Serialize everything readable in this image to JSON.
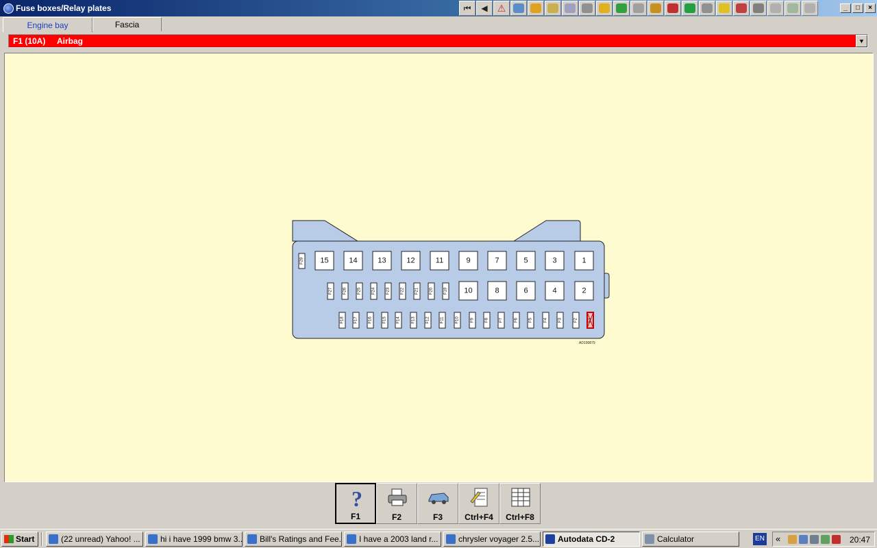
{
  "window": {
    "title": "Fuse boxes/Relay plates",
    "controls": [
      "_",
      "□",
      "×"
    ]
  },
  "toolbar": {
    "buttons": [
      {
        "icon": "first-page-icon",
        "glyph": "⏮"
      },
      {
        "icon": "back-icon",
        "glyph": "◀"
      },
      {
        "icon": "warning-icon",
        "glyph": "⚠"
      },
      {
        "icon": "engine-data-icon",
        "color": "#5a8ec8"
      },
      {
        "icon": "ignition-icon",
        "color": "#e0a020"
      },
      {
        "icon": "spark-plug-icon",
        "color": "#c8b050"
      },
      {
        "icon": "timing-icon",
        "color": "#a0a0c0"
      },
      {
        "icon": "suspension-icon",
        "color": "#909090"
      },
      {
        "icon": "fuse-icon",
        "color": "#e0b020"
      },
      {
        "icon": "relay-icon",
        "color": "#30a040"
      },
      {
        "icon": "brakes-icon",
        "color": "#a0a0a0"
      },
      {
        "icon": "tool-icon",
        "color": "#c89020"
      },
      {
        "icon": "injection-icon",
        "color": "#c03030"
      },
      {
        "icon": "electrical-icon",
        "color": "#20a040"
      },
      {
        "icon": "belt-icon",
        "color": "#909090"
      },
      {
        "icon": "fault-code-icon",
        "color": "#e0c020"
      },
      {
        "icon": "service-icon",
        "color": "#c04040"
      },
      {
        "icon": "lamp-icon",
        "color": "#808080"
      },
      {
        "icon": "airbag-icon",
        "color": "#b0b0b0"
      },
      {
        "icon": "wiring-icon",
        "color": "#a0b8a0"
      },
      {
        "icon": "fuse-box-icon",
        "color": "#b0b0b0"
      }
    ]
  },
  "tabs": [
    {
      "label": "Engine bay",
      "active": true
    },
    {
      "label": "Fascia",
      "active": false
    }
  ],
  "selector": {
    "code": "F1 (10A)",
    "label": "Airbag",
    "color": "#ff0000"
  },
  "diagram": {
    "panel_color": "#fffbd0",
    "box_color": "#b8cce8",
    "highlight_color": "#cc0000",
    "reference": "AD100879",
    "relay_top": [
      "15",
      "14",
      "13",
      "12",
      "11",
      "9",
      "7",
      "5",
      "3",
      "1"
    ],
    "relay_mid": [
      "10",
      "8",
      "6",
      "4",
      "2"
    ],
    "fuse_side": "F28",
    "fuse_mid": [
      "F27",
      "F26",
      "F25",
      "F24",
      "F23",
      "F22",
      "F21",
      "F20",
      "F19"
    ],
    "fuse_bottom": [
      "F18",
      "F17",
      "F16",
      "F15",
      "F14",
      "F13",
      "F12",
      "F11",
      "F10",
      "F9",
      "F8",
      "F7",
      "F6",
      "F5",
      "F4",
      "F3",
      "F2",
      "F1"
    ],
    "selected_fuse": "F1"
  },
  "function_bar": [
    {
      "label": "F1",
      "icon": "help-icon",
      "pressed": true
    },
    {
      "label": "F2",
      "icon": "printer-icon",
      "pressed": false
    },
    {
      "label": "F3",
      "icon": "vehicle-icon",
      "pressed": false
    },
    {
      "label": "Ctrl+F4",
      "icon": "notes-icon",
      "pressed": false
    },
    {
      "label": "Ctrl+F8",
      "icon": "table-icon",
      "pressed": false
    }
  ],
  "taskbar": {
    "start_label": "Start",
    "tasks": [
      {
        "label": "(22 unread) Yahoo! ...",
        "icon": "ie-icon",
        "active": false
      },
      {
        "label": "hi i have 1999 bmw 3...",
        "icon": "ie-icon",
        "active": false
      },
      {
        "label": "Bill's Ratings and Fee...",
        "icon": "ie-icon",
        "active": false
      },
      {
        "label": "I have a 2003 land r...",
        "icon": "ie-icon",
        "active": false
      },
      {
        "label": "chrysler voyager 2.5...",
        "icon": "ie-icon",
        "active": false
      },
      {
        "label": "Autodata CD-2",
        "icon": "autodata-icon",
        "active": true
      },
      {
        "label": "Calculator",
        "icon": "calculator-icon",
        "active": false
      }
    ],
    "language": "EN",
    "tray_chevron": "«",
    "clock": "20:47"
  }
}
